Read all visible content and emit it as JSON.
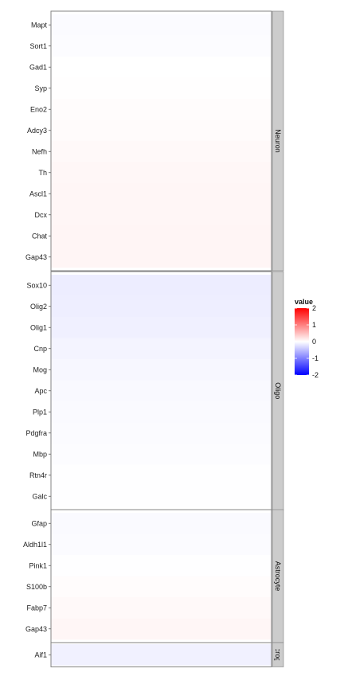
{
  "chart_data": {
    "type": "heatmap",
    "legend": {
      "title": "value",
      "ticks": [
        2,
        1,
        0,
        -1,
        -2
      ],
      "range": [
        -2,
        2
      ],
      "colors": {
        "low": "#0000ff",
        "mid": "#ffffff",
        "high": "#ff0000"
      },
      "placement": "right"
    },
    "panels": [
      {
        "name": "Neuron",
        "genes": [
          "Mapt",
          "Sort1",
          "Gad1",
          "Syp",
          "Eno2",
          "Adcy3",
          "Nefh",
          "Th",
          "Ascl1",
          "Dcx",
          "Chat",
          "Gap43"
        ],
        "values": [
          -0.03,
          -0.02,
          0.0,
          0.01,
          0.02,
          0.03,
          0.05,
          0.06,
          0.07,
          0.07,
          0.08,
          0.08
        ]
      },
      {
        "name": "Oligo",
        "genes": [
          "Sox10",
          "Olig2",
          "Olig1",
          "Cnp",
          "Mog",
          "Apc",
          "Plp1",
          "Pdgfra",
          "Mbp",
          "Rtn4r",
          "Galc"
        ],
        "values": [
          -0.14,
          -0.13,
          -0.12,
          -0.09,
          -0.06,
          -0.05,
          -0.04,
          -0.03,
          -0.02,
          -0.01,
          -0.005
        ]
      },
      {
        "name": "Astrocyte",
        "genes": [
          "Gfap",
          "Aldh1l1",
          "Pink1",
          "S100b",
          "Fabp7",
          "Gap43"
        ],
        "values": [
          -0.04,
          -0.03,
          -0.01,
          0.02,
          0.05,
          0.07
        ]
      },
      {
        "name": "Microglia",
        "genes": [
          "Aif1"
        ],
        "values": [
          -0.11
        ]
      }
    ]
  }
}
